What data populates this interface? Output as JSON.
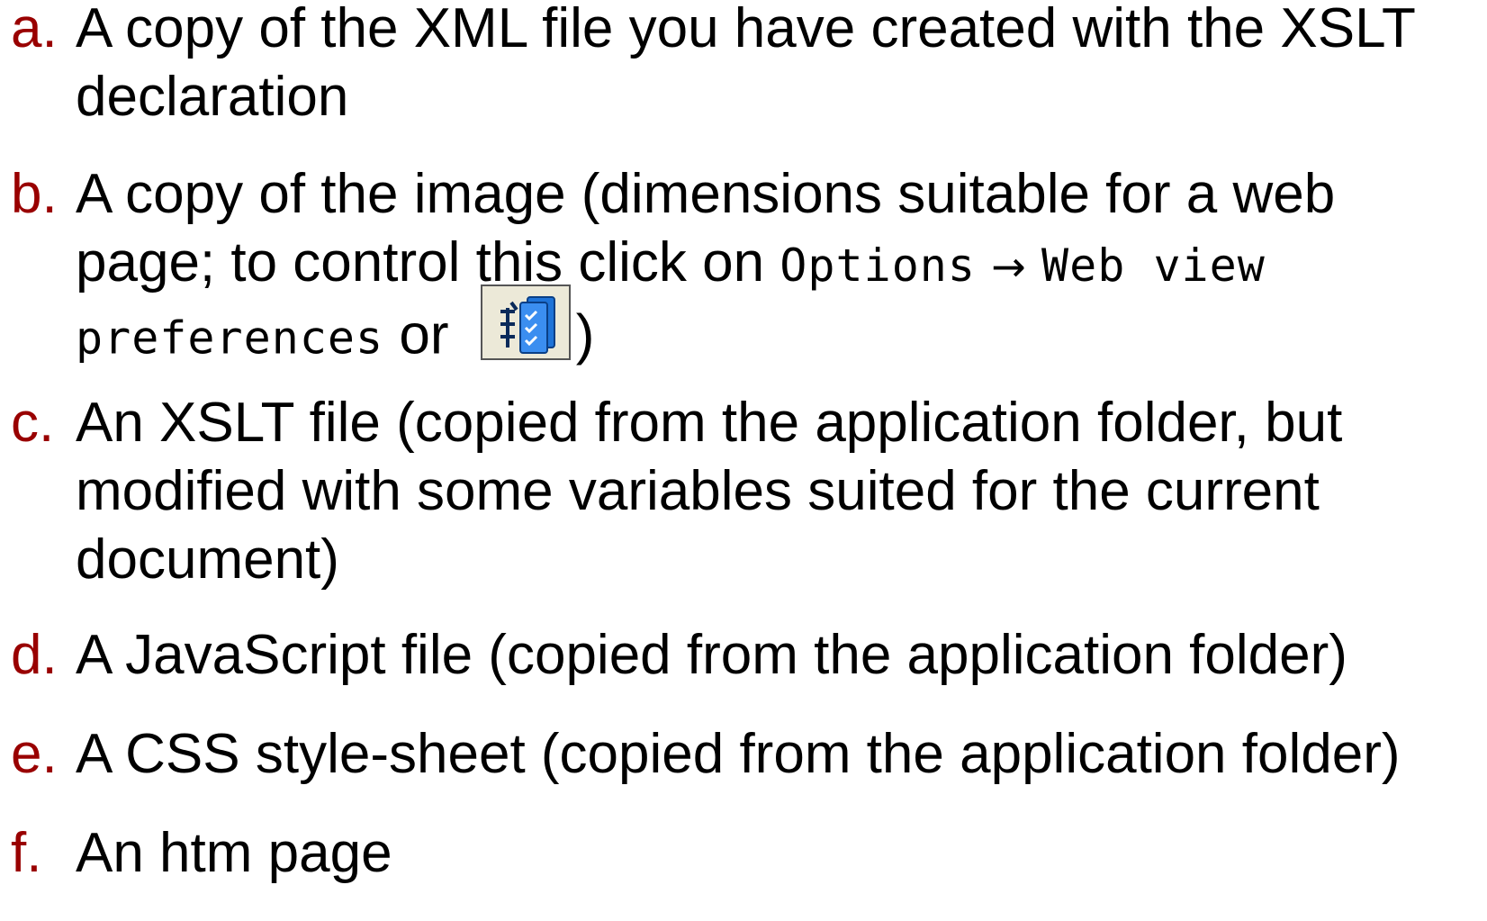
{
  "items": [
    {
      "marker": "a.",
      "line1": "A copy of the XML file you have created with the XSLT",
      "line2": "declaration"
    },
    {
      "marker": "b.",
      "line1": "A copy of the image (dimensions suitable for a web",
      "line2_text": "page; to control this click on ",
      "line2_menu1": "Options",
      "arrow": "→",
      "line2_menu2": "Web view",
      "line3_menu3": "preferences",
      "line3_or": " or ",
      "line3_close": ")",
      "icon": "web-view-preferences-icon"
    },
    {
      "marker": "c.",
      "line1": "An XSLT file (copied from the application folder, but",
      "line2": "modified with some variables suited for the current",
      "line3": "document)"
    },
    {
      "marker": "d.",
      "line1": "A JavaScript file (copied from the application folder)"
    },
    {
      "marker": "e.",
      "line1": "A CSS style-sheet (copied from the application folder)"
    },
    {
      "marker": "f.",
      "line1": "An htm page"
    }
  ],
  "colors": {
    "marker": "#990000",
    "text": "#000000",
    "icon_bg": "#ece9d8",
    "icon_blue": "#1e73d8"
  }
}
